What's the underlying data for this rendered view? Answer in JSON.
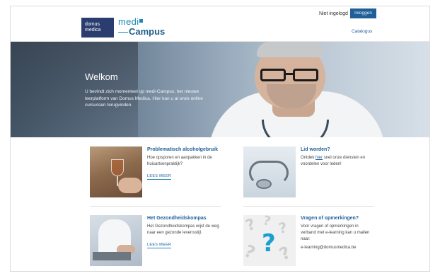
{
  "header": {
    "logo_domus_line1": "domus",
    "logo_domus_line2": "medica",
    "logo_medi": "medi",
    "logo_campus": "Campus",
    "not_logged_in": "Niet ingelogd",
    "login_button": "Inloggen",
    "catalogus_link": "Catalogus",
    "accent_color": "#1f5f99"
  },
  "hero": {
    "title": "Welkom",
    "text": "U bevindt zich momenteel op medi-Campus, het nieuwe leerplatform van Domus Medica. Hier kan u al onze online cursussen terugvinden."
  },
  "cards": [
    {
      "title": "Problematisch alcoholgebruik",
      "text": "Hoe opsporen en aanpakken in de huisartsenpraktijk?",
      "more": "LEES MEER",
      "image_icon": "wine-glass-image"
    },
    {
      "title": "Lid worden?",
      "text_before": "Ontdek ",
      "link": "hier",
      "text_after": " snel onze diensten en voordelen voor leden!",
      "image_icon": "stethoscope-image"
    },
    {
      "title": "Het Gezondheidskompas",
      "text": "Het Gezondheidskompas wijst de weg naar een gezonde levensstijl.",
      "more": "LEES MEER",
      "image_icon": "doctor-laptop-image"
    },
    {
      "title": "Vragen of opmerkingen?",
      "text": "Voor vragen of opmerkingen in verband met e-learning kan u mailen naar:",
      "email": "e-learning@domusmedica.be",
      "image_icon": "question-marks-image"
    }
  ]
}
